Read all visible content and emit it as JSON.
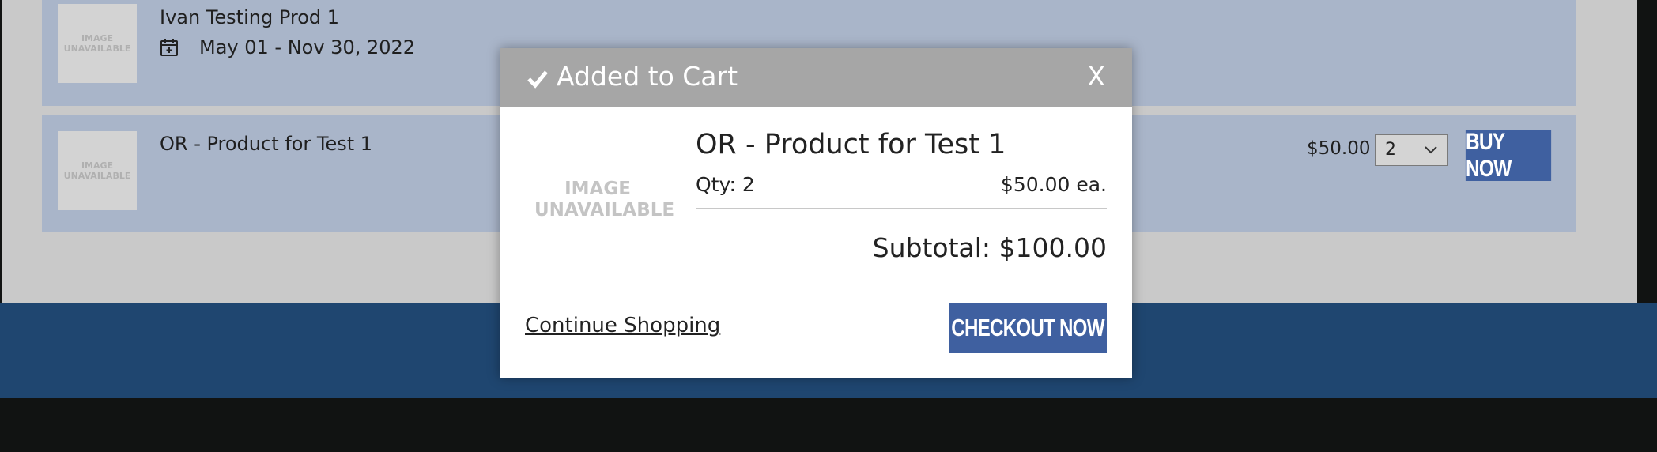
{
  "products": [
    {
      "thumb_line1": "IMAGE",
      "thumb_line2": "UNAVAILABLE",
      "name": "Ivan Testing Prod 1",
      "dates": "May 01 - Nov 30, 2022"
    },
    {
      "thumb_line1": "IMAGE",
      "thumb_line2": "UNAVAILABLE",
      "name": "OR - Product for Test 1",
      "price": "$50.00",
      "qty_selected": "2",
      "buy_label": "BUY NOW"
    }
  ],
  "modal": {
    "title": "Added to Cart",
    "close_label": "X",
    "image_line1": "IMAGE",
    "image_line2": "UNAVAILABLE",
    "product_name": "OR - Product for Test 1",
    "qty_text": "Qty: 2",
    "each_price": "$50.00 ea.",
    "subtotal": "Subtotal: $100.00",
    "continue_label": "Continue Shopping",
    "checkout_label": "CHECKOUT NOW"
  },
  "icons": {
    "calendar": "calendar-plus-icon",
    "check": "check-icon",
    "dropdown": "chevron-down-icon"
  },
  "colors": {
    "accent_button": "#3f60a0",
    "row_background": "#a9b5c9",
    "footer_blue": "#1f4670",
    "modal_header": "#a6a6a6"
  }
}
